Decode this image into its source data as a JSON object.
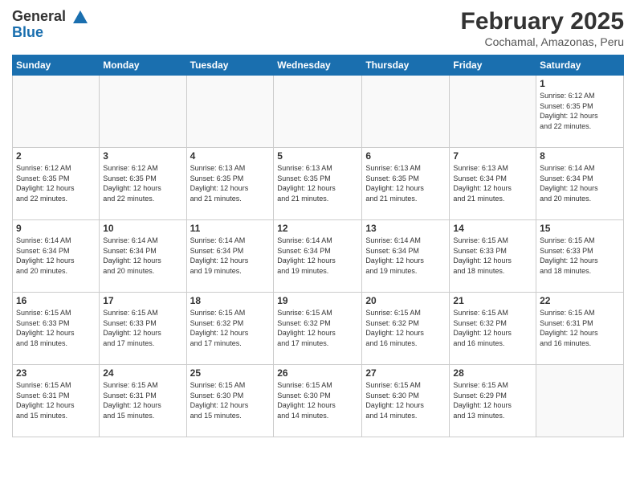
{
  "header": {
    "logo_line1": "General",
    "logo_line2": "Blue",
    "title": "February 2025",
    "subtitle": "Cochamal, Amazonas, Peru"
  },
  "days_of_week": [
    "Sunday",
    "Monday",
    "Tuesday",
    "Wednesday",
    "Thursday",
    "Friday",
    "Saturday"
  ],
  "weeks": [
    [
      {
        "day": "",
        "info": ""
      },
      {
        "day": "",
        "info": ""
      },
      {
        "day": "",
        "info": ""
      },
      {
        "day": "",
        "info": ""
      },
      {
        "day": "",
        "info": ""
      },
      {
        "day": "",
        "info": ""
      },
      {
        "day": "1",
        "info": "Sunrise: 6:12 AM\nSunset: 6:35 PM\nDaylight: 12 hours\nand 22 minutes."
      }
    ],
    [
      {
        "day": "2",
        "info": "Sunrise: 6:12 AM\nSunset: 6:35 PM\nDaylight: 12 hours\nand 22 minutes."
      },
      {
        "day": "3",
        "info": "Sunrise: 6:12 AM\nSunset: 6:35 PM\nDaylight: 12 hours\nand 22 minutes."
      },
      {
        "day": "4",
        "info": "Sunrise: 6:13 AM\nSunset: 6:35 PM\nDaylight: 12 hours\nand 21 minutes."
      },
      {
        "day": "5",
        "info": "Sunrise: 6:13 AM\nSunset: 6:35 PM\nDaylight: 12 hours\nand 21 minutes."
      },
      {
        "day": "6",
        "info": "Sunrise: 6:13 AM\nSunset: 6:35 PM\nDaylight: 12 hours\nand 21 minutes."
      },
      {
        "day": "7",
        "info": "Sunrise: 6:13 AM\nSunset: 6:34 PM\nDaylight: 12 hours\nand 21 minutes."
      },
      {
        "day": "8",
        "info": "Sunrise: 6:14 AM\nSunset: 6:34 PM\nDaylight: 12 hours\nand 20 minutes."
      }
    ],
    [
      {
        "day": "9",
        "info": "Sunrise: 6:14 AM\nSunset: 6:34 PM\nDaylight: 12 hours\nand 20 minutes."
      },
      {
        "day": "10",
        "info": "Sunrise: 6:14 AM\nSunset: 6:34 PM\nDaylight: 12 hours\nand 20 minutes."
      },
      {
        "day": "11",
        "info": "Sunrise: 6:14 AM\nSunset: 6:34 PM\nDaylight: 12 hours\nand 19 minutes."
      },
      {
        "day": "12",
        "info": "Sunrise: 6:14 AM\nSunset: 6:34 PM\nDaylight: 12 hours\nand 19 minutes."
      },
      {
        "day": "13",
        "info": "Sunrise: 6:14 AM\nSunset: 6:34 PM\nDaylight: 12 hours\nand 19 minutes."
      },
      {
        "day": "14",
        "info": "Sunrise: 6:15 AM\nSunset: 6:33 PM\nDaylight: 12 hours\nand 18 minutes."
      },
      {
        "day": "15",
        "info": "Sunrise: 6:15 AM\nSunset: 6:33 PM\nDaylight: 12 hours\nand 18 minutes."
      }
    ],
    [
      {
        "day": "16",
        "info": "Sunrise: 6:15 AM\nSunset: 6:33 PM\nDaylight: 12 hours\nand 18 minutes."
      },
      {
        "day": "17",
        "info": "Sunrise: 6:15 AM\nSunset: 6:33 PM\nDaylight: 12 hours\nand 17 minutes."
      },
      {
        "day": "18",
        "info": "Sunrise: 6:15 AM\nSunset: 6:32 PM\nDaylight: 12 hours\nand 17 minutes."
      },
      {
        "day": "19",
        "info": "Sunrise: 6:15 AM\nSunset: 6:32 PM\nDaylight: 12 hours\nand 17 minutes."
      },
      {
        "day": "20",
        "info": "Sunrise: 6:15 AM\nSunset: 6:32 PM\nDaylight: 12 hours\nand 16 minutes."
      },
      {
        "day": "21",
        "info": "Sunrise: 6:15 AM\nSunset: 6:32 PM\nDaylight: 12 hours\nand 16 minutes."
      },
      {
        "day": "22",
        "info": "Sunrise: 6:15 AM\nSunset: 6:31 PM\nDaylight: 12 hours\nand 16 minutes."
      }
    ],
    [
      {
        "day": "23",
        "info": "Sunrise: 6:15 AM\nSunset: 6:31 PM\nDaylight: 12 hours\nand 15 minutes."
      },
      {
        "day": "24",
        "info": "Sunrise: 6:15 AM\nSunset: 6:31 PM\nDaylight: 12 hours\nand 15 minutes."
      },
      {
        "day": "25",
        "info": "Sunrise: 6:15 AM\nSunset: 6:30 PM\nDaylight: 12 hours\nand 15 minutes."
      },
      {
        "day": "26",
        "info": "Sunrise: 6:15 AM\nSunset: 6:30 PM\nDaylight: 12 hours\nand 14 minutes."
      },
      {
        "day": "27",
        "info": "Sunrise: 6:15 AM\nSunset: 6:30 PM\nDaylight: 12 hours\nand 14 minutes."
      },
      {
        "day": "28",
        "info": "Sunrise: 6:15 AM\nSunset: 6:29 PM\nDaylight: 12 hours\nand 13 minutes."
      },
      {
        "day": "",
        "info": ""
      }
    ]
  ]
}
